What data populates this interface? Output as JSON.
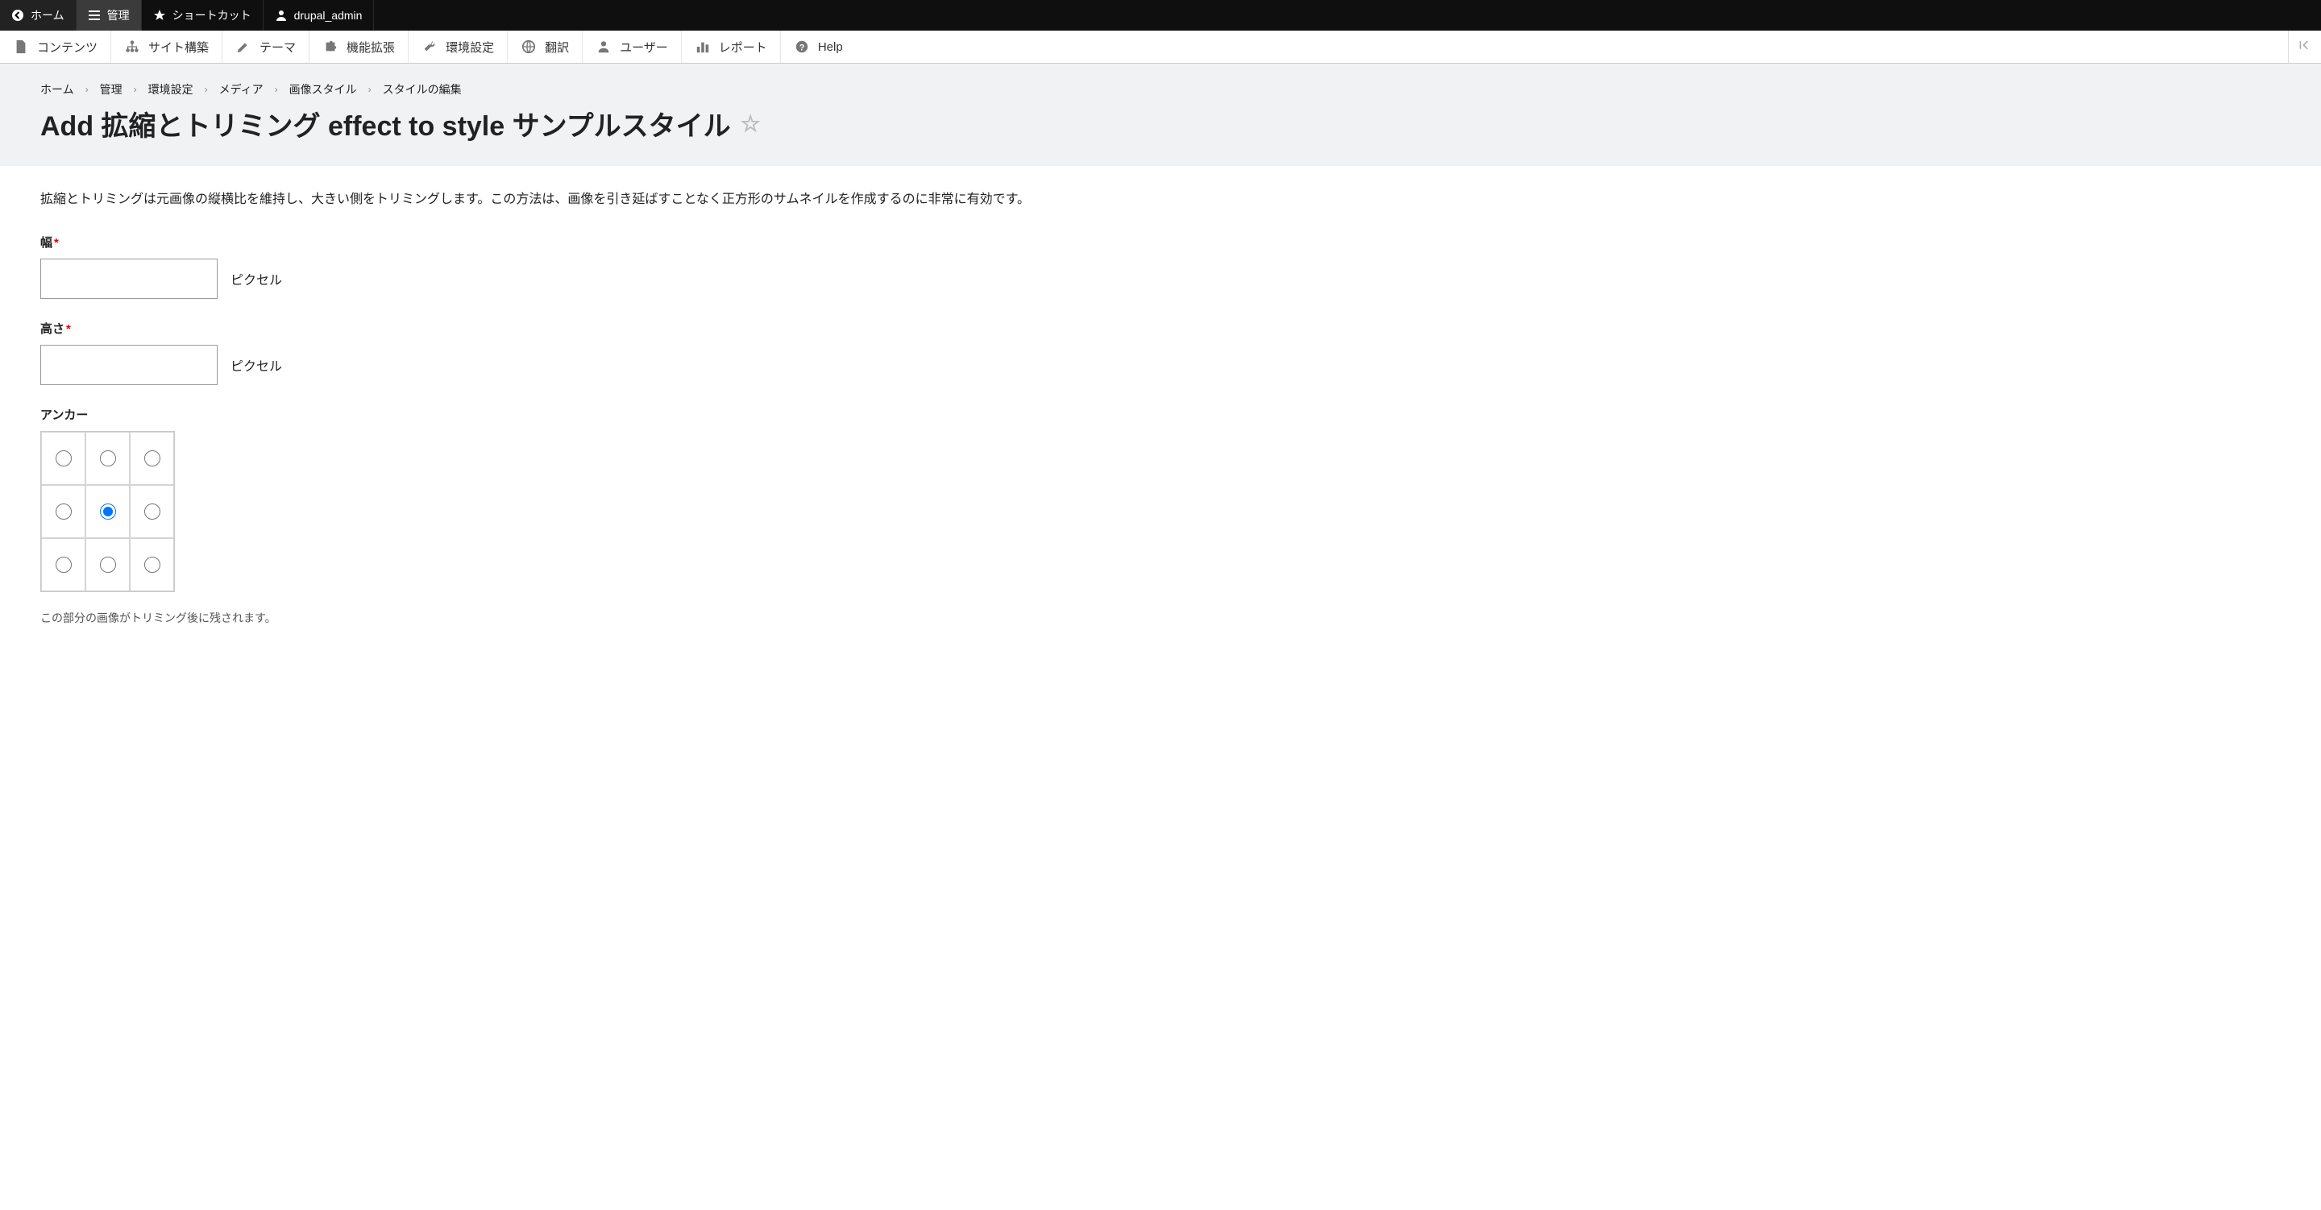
{
  "topbar": {
    "home": "ホーム",
    "manage": "管理",
    "shortcuts": "ショートカット",
    "user": "drupal_admin"
  },
  "adminmenu": {
    "items": [
      {
        "label": "コンテンツ"
      },
      {
        "label": "サイト構築"
      },
      {
        "label": "テーマ"
      },
      {
        "label": "機能拡張"
      },
      {
        "label": "環境設定"
      },
      {
        "label": "翻訳"
      },
      {
        "label": "ユーザー"
      },
      {
        "label": "レポート"
      },
      {
        "label": "Help"
      }
    ]
  },
  "breadcrumb": [
    "ホーム",
    "管理",
    "環境設定",
    "メディア",
    "画像スタイル",
    "スタイルの編集"
  ],
  "page_title": "Add 拡縮とトリミング effect to style サンプルスタイル",
  "description": "拡縮とトリミングは元画像の縦横比を維持し、大きい側をトリミングします。この方法は、画像を引き延ばすことなく正方形のサムネイルを作成するのに非常に有効です。",
  "form": {
    "width": {
      "label": "幅",
      "value": "",
      "suffix": "ピクセル"
    },
    "height": {
      "label": "高さ",
      "value": "",
      "suffix": "ピクセル"
    },
    "anchor": {
      "label": "アンカー",
      "help": "この部分の画像がトリミング後に残されます。",
      "selected": "center-center"
    }
  }
}
